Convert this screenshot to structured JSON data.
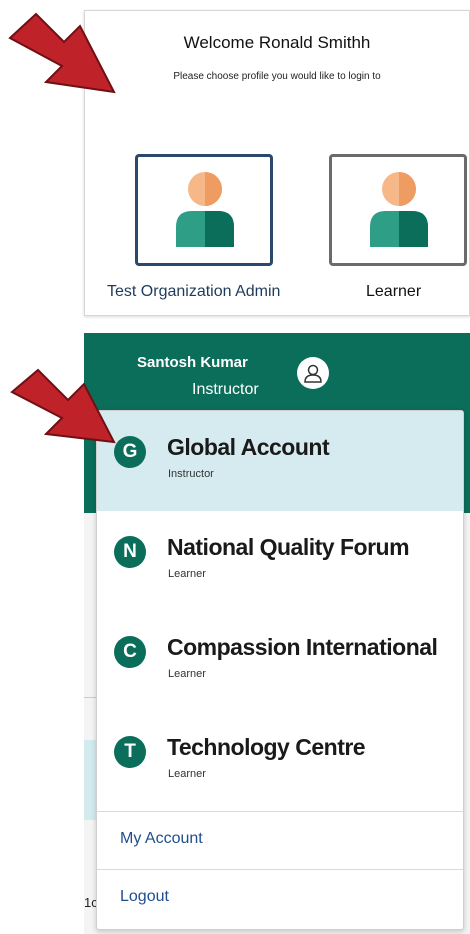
{
  "chooser": {
    "welcome": "Welcome Ronald Smithh",
    "subtitle": "Please choose profile you would like to login to",
    "profiles": [
      {
        "label": "Test Organization Admin"
      },
      {
        "label": "Learner"
      }
    ]
  },
  "account_menu": {
    "user_name": "Santosh Kumar",
    "user_role": "Instructor",
    "accounts": [
      {
        "initial": "G",
        "name": "Global Account",
        "role": "Instructor",
        "active": true
      },
      {
        "initial": "N",
        "name": "National Quality Forum",
        "role": "Learner",
        "active": false
      },
      {
        "initial": "C",
        "name": "Compassion International",
        "role": "Learner",
        "active": false
      },
      {
        "initial": "T",
        "name": "Technology Centre",
        "role": "Learner",
        "active": false
      }
    ],
    "my_account_label": "My Account",
    "logout_label": "Logout"
  },
  "background": {
    "partial_text": "1c"
  },
  "colors": {
    "brand_green": "#0b6e5a",
    "active_row": "#d5ebef",
    "arrow_red": "#c0222a",
    "card_border": "#2b4a6b",
    "link_blue": "#1f4e8c"
  },
  "icons": [
    "user-avatar-icon",
    "user-outline-icon",
    "red-arrow-pointer"
  ]
}
